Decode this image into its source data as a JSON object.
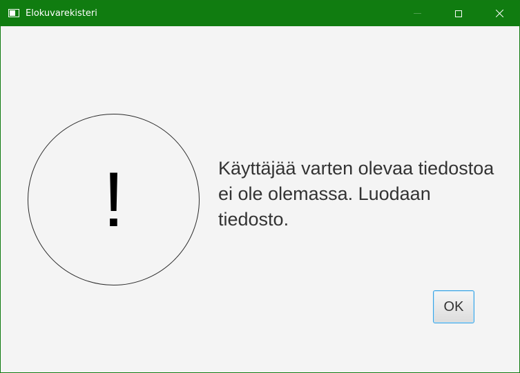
{
  "window": {
    "title": "Elokuvarekisteri",
    "icon": "app-window-icon",
    "controls": {
      "minimize_icon": "minimize-icon",
      "maximize_icon": "maximize-icon",
      "close_icon": "close-icon"
    },
    "titlebar_color": "#107c10"
  },
  "dialog": {
    "icon": "warning-icon",
    "icon_glyph": "!",
    "message": "Käyttäjää varten olevaa tiedostoa\nei ole olemassa. Luodaan\ntiedosto.",
    "ok_label": "OK",
    "focus_color": "#39a3e3"
  }
}
